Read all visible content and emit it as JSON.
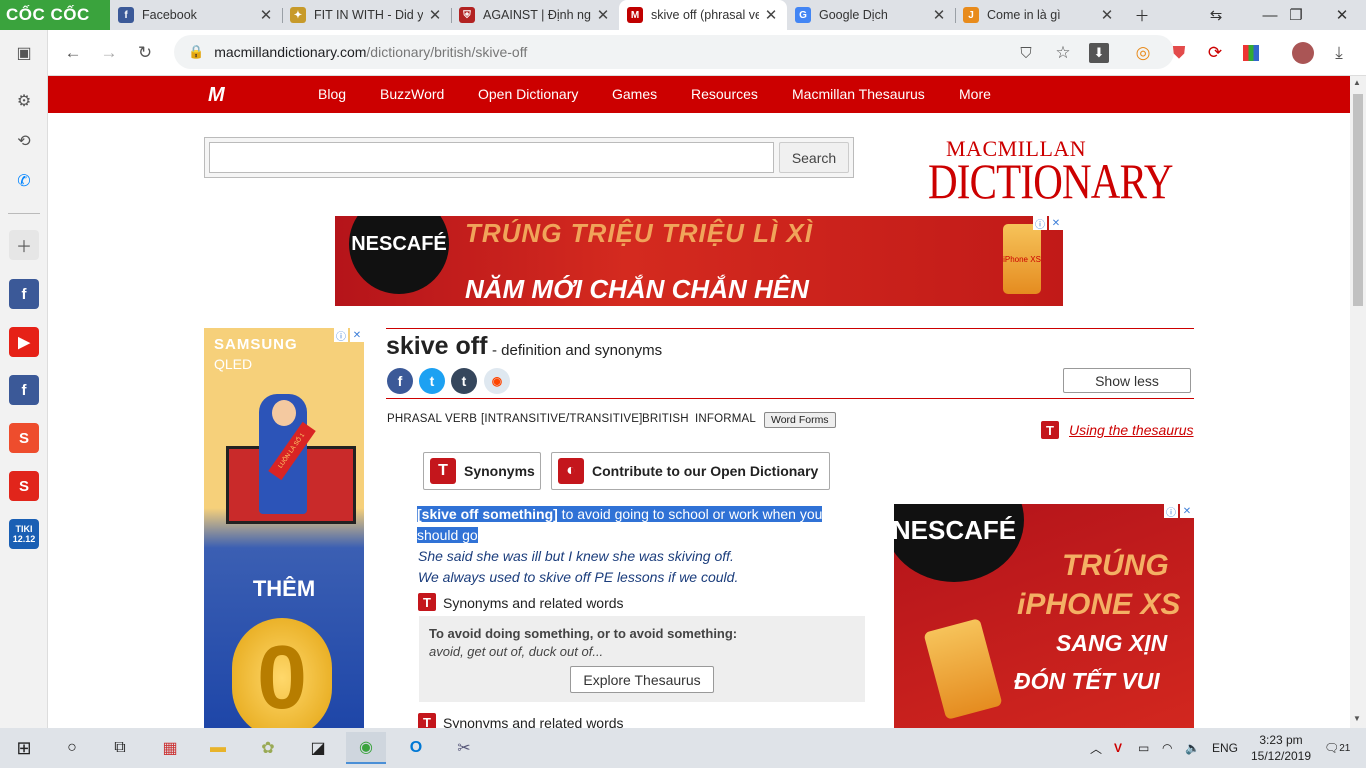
{
  "browser": {
    "brand": "CỐC CỐC",
    "tabs": [
      {
        "title": "Facebook",
        "favicon": "facebook-icon",
        "color": "#3b5998",
        "glyph": "f"
      },
      {
        "title": "FIT IN WITH - Did you",
        "favicon": "puzzle-icon",
        "color": "#c79a2a",
        "glyph": "✦"
      },
      {
        "title": "AGAINST | Định nghĩa",
        "favicon": "cambridge-icon",
        "color": "#b22222",
        "glyph": "⛨"
      },
      {
        "title": "skive off (phrasal verb",
        "favicon": "macmillan-icon",
        "color": "#c00000",
        "glyph": "M"
      },
      {
        "title": "Google Dịch",
        "favicon": "google-translate-icon",
        "color": "#4285f4",
        "glyph": "G"
      },
      {
        "title": "Come in là gì",
        "favicon": "j-icon",
        "color": "#e88b1c",
        "glyph": "J"
      }
    ],
    "url_host": "macmillandictionary.com",
    "url_path": "/dictionary/british/skive-off"
  },
  "nav": {
    "links": [
      "Blog",
      "BuzzWord",
      "Open Dictionary",
      "Games",
      "Resources",
      "Macmillan Thesaurus",
      "More"
    ]
  },
  "search": {
    "value": "",
    "button": "Search"
  },
  "brand": {
    "line1": "MACMILLAN",
    "line2": "DICTIONARY"
  },
  "ads": {
    "top": {
      "brand": "NESCAFÉ",
      "line1": "TRÚNG TRIỆU TRIỆU LÌ XÌ",
      "line2": "NĂM MỚI CHẮN CHẮN HÊN",
      "phone": "iPhone XS"
    },
    "left": {
      "brand": "SAMSUNG",
      "model": "QLED",
      "sash": "LUÔN LÀ SỐ 1",
      "promo": "THÊM",
      "digit": "0"
    },
    "right": {
      "brand": "NESCAFÉ",
      "line1": "TRÚNG",
      "line2": "iPHONE XS",
      "line3": "SANG XỊN",
      "line4": "ĐÓN TẾT VUI"
    }
  },
  "entry": {
    "headword": "skive off",
    "subtitle": " - definition and synonyms",
    "show_less": "Show less",
    "meta": {
      "pos": "PHRASAL VERB",
      "grammar": "[INTRANSITIVE/TRANSITIVE]",
      "region": "BRITISH",
      "register": "INFORMAL",
      "word_forms": "Word Forms"
    },
    "thesaurus_link": "Using the thesaurus",
    "synonyms_button": "Synonyms",
    "contribute_button": "Contribute to our Open Dictionary",
    "def_pattern": "[skive off something]",
    "def_text_1": " to avoid going to school or work when you",
    "def_text_2": "should go",
    "def_text_3": "",
    "examples": [
      "She said she was ill but I knew she was skiving off.",
      "We always used to skive off PE lessons if we could."
    ],
    "syn_heading": "Synonyms and related words",
    "syn_panel_title": "To avoid doing something, or to avoid something:",
    "syn_panel_words": "avoid, get out of, duck out of...",
    "explore": "Explore Thesaurus",
    "syn_heading_2": "Synonyms and related words"
  },
  "taskbar": {
    "language": "ENG",
    "time": "3:23 pm",
    "date": "15/12/2019",
    "notifications": "21"
  }
}
